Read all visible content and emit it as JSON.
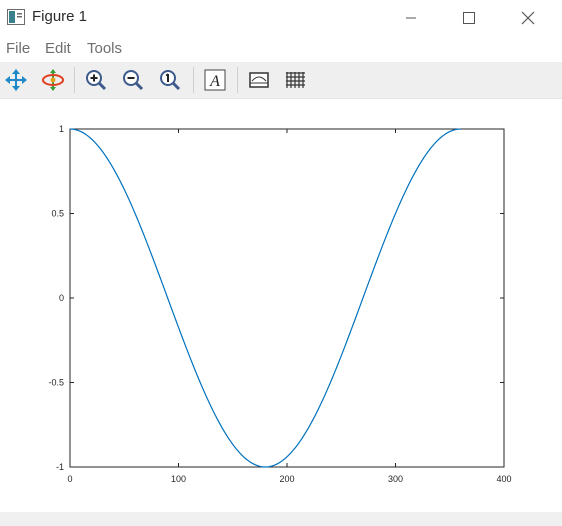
{
  "window": {
    "title": "Figure 1"
  },
  "menu": {
    "items": [
      "File",
      "Edit",
      "Tools"
    ]
  },
  "toolbar": {
    "tools": [
      "pan",
      "rotate",
      "zoom-in",
      "zoom-out",
      "zoom-auto",
      "insert-text",
      "toggle-axes",
      "toggle-grid"
    ]
  },
  "colors": {
    "line": "#0072bd",
    "axes": "#262626",
    "toolbar_bg": "#efefef"
  },
  "chart_data": {
    "type": "line",
    "title": "",
    "xlabel": "",
    "ylabel": "",
    "xlim": [
      0,
      400
    ],
    "ylim": [
      -1,
      1
    ],
    "xticks": [
      "0",
      "100",
      "200",
      "300",
      "400"
    ],
    "yticks": [
      "1",
      "0.5",
      "0",
      "-0.5",
      "-1"
    ],
    "grid": false,
    "series": [
      {
        "function": "cos(x in degrees)",
        "x": [
          0,
          20,
          40,
          60,
          80,
          100,
          120,
          140,
          160,
          180,
          200,
          220,
          240,
          260,
          280,
          300,
          320,
          340,
          360
        ],
        "values": [
          1,
          0.94,
          0.766,
          0.5,
          0.174,
          -0.174,
          -0.5,
          -0.766,
          -0.94,
          -1,
          -0.94,
          -0.766,
          -0.5,
          -0.174,
          0.174,
          0.5,
          0.766,
          0.94,
          1
        ]
      }
    ]
  }
}
